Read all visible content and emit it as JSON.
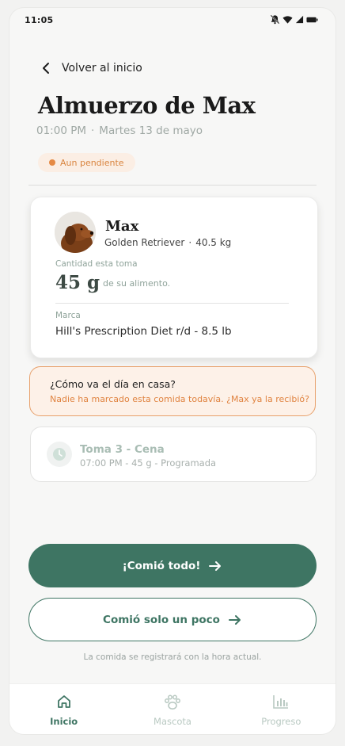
{
  "status_bar": {
    "time": "11:05",
    "icons": [
      "bell-off-icon",
      "wifi-icon",
      "signal-icon",
      "battery-icon"
    ]
  },
  "header": {
    "back_label": "Volver al inicio",
    "title": "Almuerzo de Max",
    "time": "01:00 PM",
    "separator": "·",
    "date": "Martes 13 de mayo"
  },
  "status_badge": {
    "label": "Aun pendiente",
    "color": "#e58a45"
  },
  "pet_card": {
    "name": "Max",
    "breed": "Golden Retriever",
    "separator": "·",
    "weight": "40.5 kg",
    "quantity_label": "Cantidad esta toma",
    "quantity_value": "45 g",
    "quantity_suffix": "de su alimento.",
    "brand_label": "Marca",
    "brand_value": "Hill's Prescription Diet r/d - 8.5 lb"
  },
  "alert": {
    "title": "¿Cómo va el día en casa?",
    "text": "Nadie ha marcado esta comida todavía. ¿Max ya la recibió?"
  },
  "next_meal": {
    "title": "Toma 3 - Cena",
    "detail": "07:00 PM - 45 g - Programada",
    "icon": "clock-icon"
  },
  "actions": {
    "primary_label": "¡Comió todo!",
    "secondary_label": "Comió solo un poco",
    "footnote": "La comida se registrará con la hora actual."
  },
  "nav": {
    "items": [
      {
        "label": "Inicio",
        "icon": "home-icon",
        "active": true
      },
      {
        "label": "Mascota",
        "icon": "paw-icon",
        "active": false
      },
      {
        "label": "Progreso",
        "icon": "bar-chart-icon",
        "active": false
      }
    ]
  },
  "colors": {
    "primary": "#3e7563",
    "accent_orange": "#e58a45",
    "background": "#f7f7f6"
  }
}
